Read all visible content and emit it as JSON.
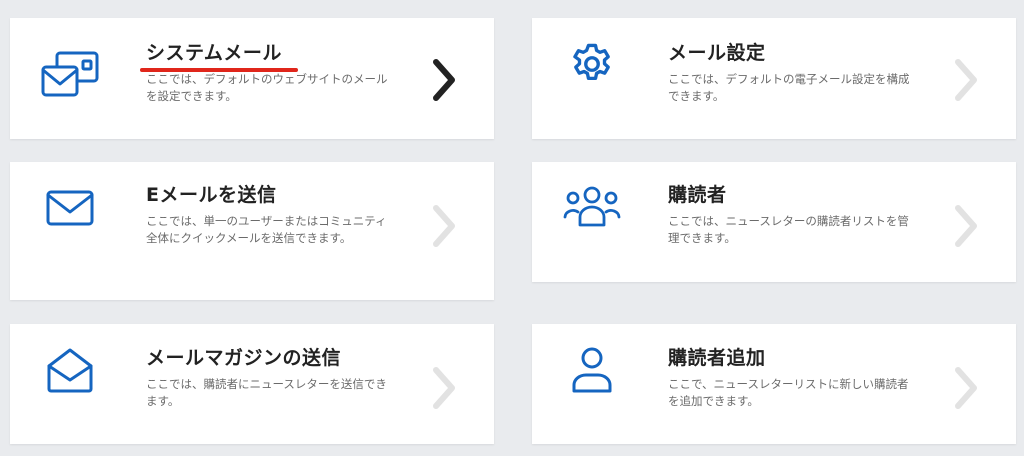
{
  "colors": {
    "background": "#e9ebee",
    "card": "#ffffff",
    "icon": "#1565c0",
    "chevron_active": "#222222",
    "chevron_inactive": "#e2e2e2",
    "underline": "#e0261b"
  },
  "cards": [
    {
      "title": "システムメール",
      "description": "ここでは、デフォルトのウェブサイトのメールを設定できます。",
      "icon": "system-mail-icon",
      "chevron_active": true,
      "underlined": true
    },
    {
      "title": "メール設定",
      "description": "ここでは、デフォルトの電子メール設定を構成できます。",
      "icon": "gear-icon",
      "chevron_active": false
    },
    {
      "title": "Eメールを送信",
      "description": "ここでは、単一のユーザーまたはコミュニティ全体にクイックメールを送信できます。",
      "icon": "envelope-icon",
      "chevron_active": false
    },
    {
      "title": "購読者",
      "description": "ここでは、ニュースレターの購読者リストを管理できます。",
      "icon": "users-icon",
      "chevron_active": false
    },
    {
      "title": "メールマガジンの送信",
      "description": "ここでは、購読者にニュースレターを送信できます。",
      "icon": "open-envelope-icon",
      "chevron_active": false
    },
    {
      "title": "購読者追加",
      "description": "ここで、ニュースレターリストに新しい購読者を追加できます。",
      "icon": "user-icon",
      "chevron_active": false
    }
  ]
}
